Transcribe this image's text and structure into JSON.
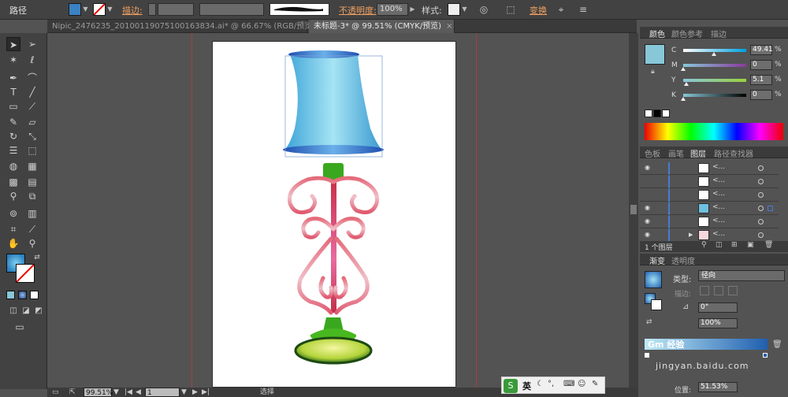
{
  "control_bar": {
    "path_label": "路径",
    "stroke_label": "描边:",
    "opacity_label": "不透明度:",
    "opacity_value": "100%",
    "style_label": "样式:",
    "transform_label": "变换"
  },
  "tabs": [
    {
      "label": "Nipic_2476235_20100119075100163834.ai* @ 66.67% (RGB/预览)",
      "close": "×"
    },
    {
      "label": "未标题-3* @ 99.51% (CMYK/预览)",
      "close": "×"
    }
  ],
  "status_bar": {
    "zoom": "99.51%",
    "page": "1",
    "mode": "选择"
  },
  "color_panel": {
    "tabs": [
      "颜色",
      "颜色参考",
      "描边"
    ],
    "channels": [
      {
        "label": "C",
        "value": "49.41",
        "fraction": 0.49
      },
      {
        "label": "M",
        "value": "0",
        "fraction": 0.0
      },
      {
        "label": "Y",
        "value": "5.1",
        "fraction": 0.05
      },
      {
        "label": "K",
        "value": "0",
        "fraction": 0.0
      }
    ],
    "unit": "%",
    "colors": {
      "cyan": "#88c7d8",
      "magenta": "#d03a9a",
      "yellow": "#d6d640"
    }
  },
  "layers_panel": {
    "tabs": [
      "色板",
      "画笔",
      "图层",
      "路径查找器"
    ],
    "rows": [
      {
        "name": "<...",
        "visible": true
      },
      {
        "name": "<...",
        "visible": false
      },
      {
        "name": "<...",
        "visible": false
      },
      {
        "name": "<...",
        "visible": true
      },
      {
        "name": "<...",
        "visible": true
      },
      {
        "name": "<...",
        "visible": true
      }
    ],
    "layer_count": "1 个图层"
  },
  "gradient_panel": {
    "tabs": [
      "渐变",
      "透明度"
    ],
    "type_label": "类型:",
    "type_value": "径向",
    "stroke_label": "描边:",
    "angle_value": "0°",
    "ratio_value": "100%",
    "position_label": "位置:",
    "position_value": "51.53%"
  },
  "ime_bar": {
    "label": "英"
  },
  "watermark": {
    "text1": "Gm 经验",
    "text2": "jingyan.baidu.com"
  },
  "icons": [
    "selection-icon",
    "direct-selection-icon",
    "pen-icon",
    "type-icon",
    "brush-icon",
    "eraser-icon",
    "rotate-icon",
    "zoom-icon",
    "hand-icon",
    "eye-icon",
    "trash-icon"
  ]
}
